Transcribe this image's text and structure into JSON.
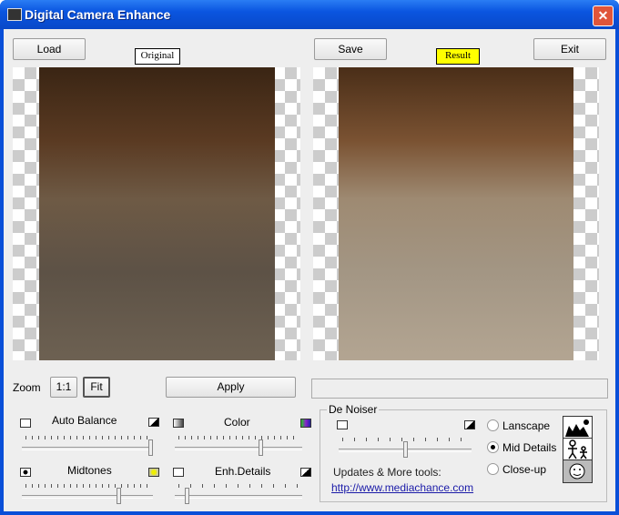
{
  "window": {
    "title": "Digital Camera Enhance",
    "close": "✕"
  },
  "toolbar": {
    "load": "Load",
    "original": "Original",
    "save": "Save",
    "result": "Result",
    "exit": "Exit"
  },
  "zoom": {
    "label": "Zoom",
    "one_to_one": "1:1",
    "fit": "Fit"
  },
  "apply": "Apply",
  "progress": 0,
  "controls": {
    "auto_balance": {
      "label": "Auto Balance",
      "value": 1.0
    },
    "color": {
      "label": "Color",
      "value": 0.68
    },
    "midtones": {
      "label": "Midtones",
      "value": 0.75
    },
    "enh_details": {
      "label": "Enh.Details",
      "value": 0.08
    }
  },
  "denoiser": {
    "title": "De Noiser",
    "value": 0.5,
    "modes": [
      {
        "label": "Lanscape",
        "selected": false
      },
      {
        "label": "Mid Details",
        "selected": true
      },
      {
        "label": "Close-up",
        "selected": false
      }
    ],
    "updates_label": "Updates & More tools:",
    "link": "http://www.mediachance.com"
  },
  "colors": {
    "titlebar": "#0a55e0",
    "result_bg": "#ffff00",
    "link": "#1a1aa8"
  }
}
